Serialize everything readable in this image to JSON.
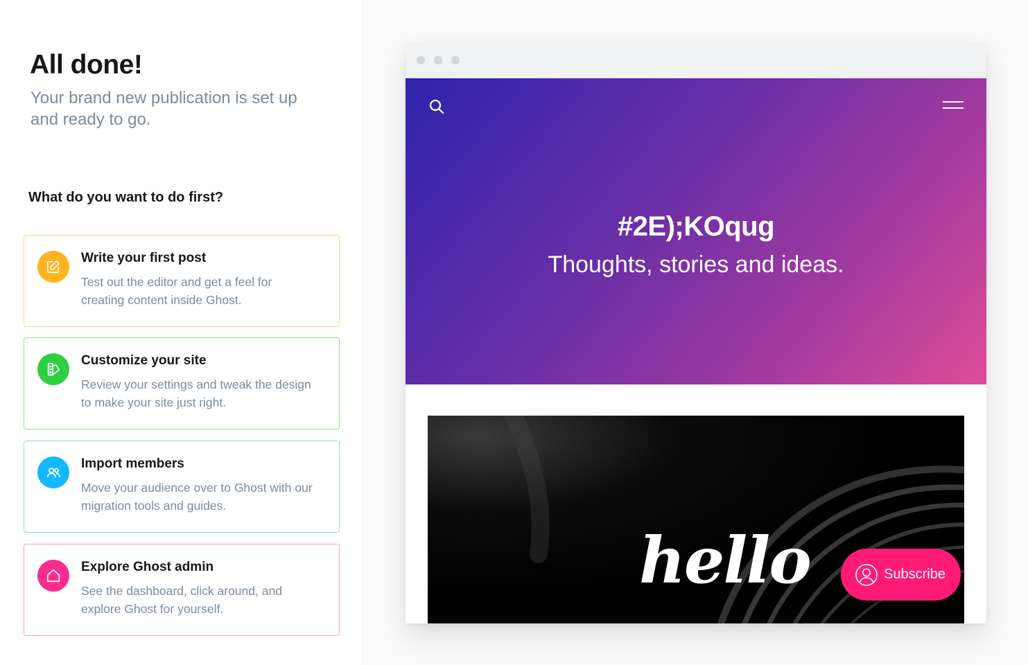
{
  "onboarding": {
    "title": "All done!",
    "subtitle": "Your brand new publication is set up and ready to go.",
    "question": "What do you want to do first?",
    "cards": [
      {
        "title": "Write your first post",
        "description": "Test out the editor and get a feel for creating content inside Ghost.",
        "icon": "edit-icon",
        "color": "#ffb41f",
        "border": "#f6d98a"
      },
      {
        "title": "Customize your site",
        "description": "Review your settings and tweak the design to make your site just right.",
        "icon": "palette-icon",
        "color": "#30cf43",
        "border": "#8fdf98"
      },
      {
        "title": "Import members",
        "description": "Move your audience over to Ghost with our migration tools and guides.",
        "icon": "members-icon",
        "color": "#14b8ff",
        "border": "#8fd6f2"
      },
      {
        "title": "Explore Ghost admin",
        "description": "See the dashboard, click around, and explore Ghost for yourself.",
        "icon": "home-icon",
        "color": "#fb2d8d",
        "border": "#f59ac7"
      }
    ]
  },
  "preview": {
    "site_title": "#2E);KOqug",
    "site_description": "Thoughts, stories and ideas.",
    "image_text": "hello",
    "subscribe_label": "Subscribe",
    "gradient_colors": [
      "#2f23ad",
      "#6a2fa7",
      "#a23a9f",
      "#de4c98"
    ],
    "subscribe_color": "#ff1a75"
  }
}
